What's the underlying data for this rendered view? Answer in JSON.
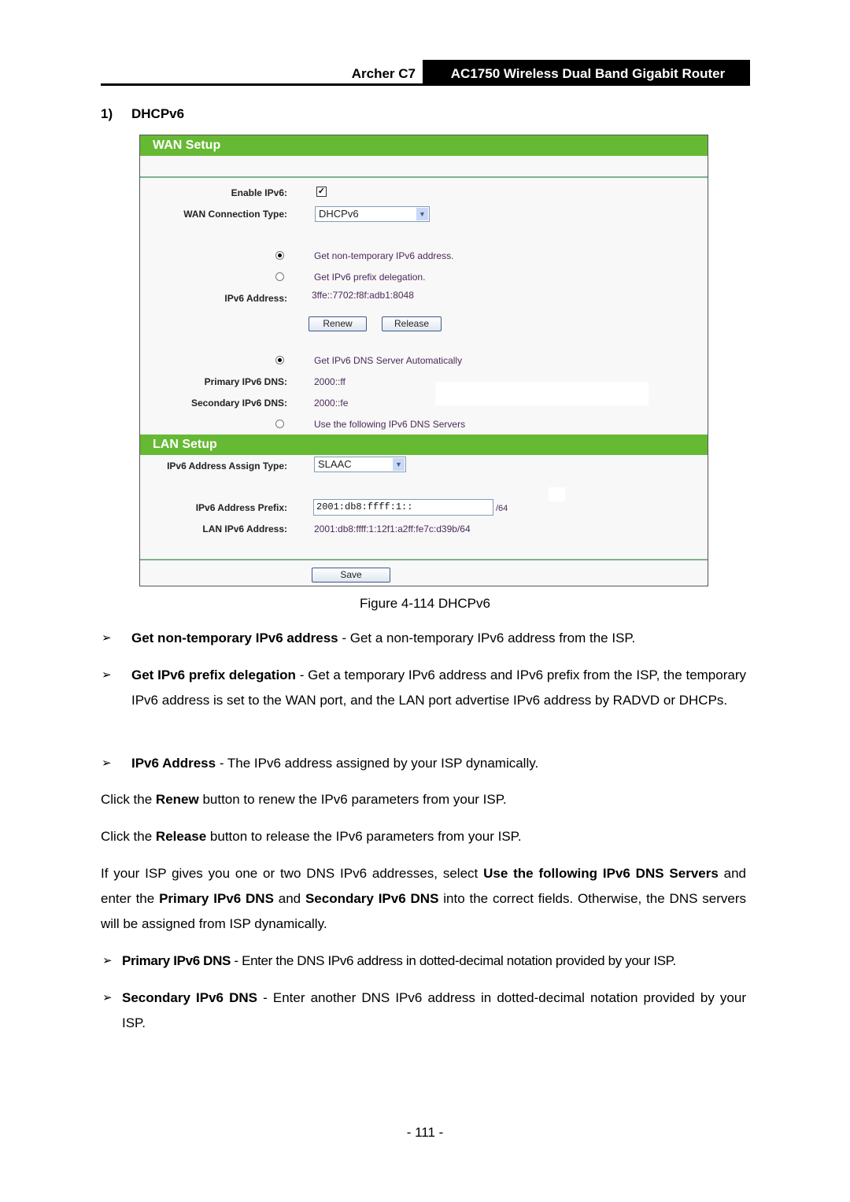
{
  "header": {
    "model": "Archer C7",
    "description": "AC1750 Wireless Dual Band Gigabit Router"
  },
  "section": {
    "number": "1)",
    "title": "DHCPv6"
  },
  "panel": {
    "wan_title": "WAN Setup",
    "enable_ipv6_label": "Enable IPv6:",
    "enable_ipv6_checked": true,
    "wan_type_label": "WAN Connection Type:",
    "wan_type_value": "DHCPv6",
    "radio_nontemp": "Get non-temporary IPv6 address.",
    "radio_prefix": "Get IPv6 prefix delegation.",
    "ipv6_address_label": "IPv6 Address:",
    "ipv6_address_value": "3ffe::7702:f8f:adb1:8048",
    "renew_label": "Renew",
    "release_label": "Release",
    "radio_dns_auto": "Get IPv6 DNS Server Automatically",
    "primary_dns_label": "Primary IPv6 DNS:",
    "primary_dns_value": "2000::ff",
    "secondary_dns_label": "Secondary IPv6 DNS:",
    "secondary_dns_value": "2000::fe",
    "radio_dns_manual": "Use the following IPv6 DNS Servers",
    "lan_title": "LAN Setup",
    "assign_type_label": "IPv6 Address Assign Type:",
    "assign_type_value": "SLAAC",
    "prefix_label": "IPv6 Address Prefix:",
    "prefix_value": "2001:db8:ffff:1::",
    "prefix_suffix": "/64",
    "lan_address_label": "LAN IPv6 Address:",
    "lan_address_value": "2001:db8:ffff:1:12f1:a2ff:fe7c:d39b/64",
    "save_label": "Save"
  },
  "caption": "Figure 4-114 DHCPv6",
  "bullet_glyph": "➢",
  "body": {
    "b1_bold": "Get non-temporary IPv6 address",
    "b1_text": " - Get a non-temporary IPv6 address from the ISP.",
    "b2_bold": "Get IPv6 prefix delegation",
    "b2_text": " - Get a temporary IPv6 address and IPv6 prefix from the ISP, the temporary IPv6 address is set to the WAN port, and the LAN port advertise IPv6 address by RADVD or DHCPs.",
    "b3_bold": "IPv6 Address",
    "b3_text": " - The IPv6 address assigned by your ISP dynamically.",
    "renew_pre": "Click the ",
    "renew_bold": "Renew",
    "renew_post": " button to renew the IPv6 parameters from your ISP.",
    "release_pre": "Click the ",
    "release_bold": "Release",
    "release_post": " button to release the IPv6 parameters from your ISP.",
    "dns_1": "If your ISP gives you one or two DNS IPv6 addresses, select ",
    "dns_2": "Use the following IPv6 DNS Servers",
    "dns_3": " and enter the ",
    "dns_4": "Primary IPv6 DNS",
    "dns_5": " and ",
    "dns_6": "Secondary IPv6 DNS",
    "dns_7": " into the correct fields. Otherwise, the DNS servers will be assigned from ISP dynamically.",
    "b4_bold": "Primary IPv6 DNS",
    "b4_text": " - Enter the DNS IPv6 address in dotted-decimal notation provided by your ISP.",
    "b5_bold": "Secondary IPv6 DNS",
    "b5_text": " - Enter another DNS IPv6 address in dotted-decimal notation provided by your ISP."
  },
  "page_number": "- 111 -"
}
